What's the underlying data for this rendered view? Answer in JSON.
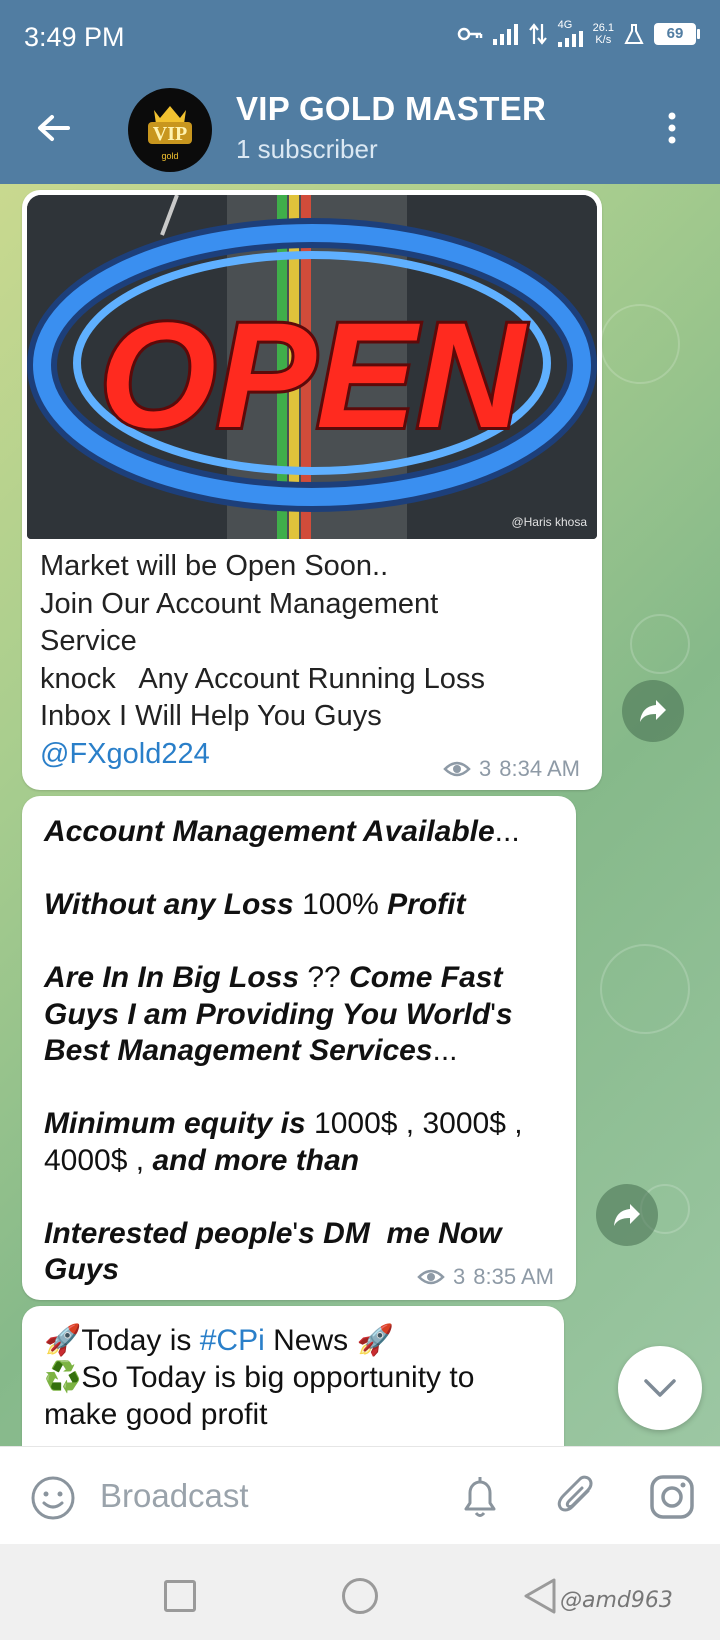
{
  "status_bar": {
    "time": "3:49 PM",
    "network": "4G",
    "speed_value": "26.1",
    "speed_unit": "K/s",
    "battery": "69",
    "icons": [
      "vpn-key-icon",
      "signal-icon",
      "data-transfer-icon",
      "signal-4g-icon",
      "flask-icon",
      "battery-icon"
    ]
  },
  "header": {
    "title": "VIP GOLD MASTER",
    "subtitle": "1 subscriber",
    "avatar_text": "VIP",
    "avatar_subtext": "gold",
    "back_icon": "arrow-left-icon",
    "menu_icon": "more-vertical-icon",
    "color": "#517da2"
  },
  "messages": [
    {
      "image_text": "OPEN",
      "image_credit": "@Haris khosa",
      "lines": [
        "Market will be Open Soon..",
        "Join Our Account Management",
        "Service",
        "knock   Any Account Running Loss",
        "Inbox I Will Help You Guys"
      ],
      "link": "@FXgold224",
      "views": "3",
      "time": "8:34 AM"
    },
    {
      "p1_bold": "Account Management Available",
      "p1_tail": "...",
      "p2_bold1": "Without any Loss",
      "p2_plain": " 100% ",
      "p2_bold2": "Profit",
      "p3_l1_bold1": "Are In In Big Loss",
      "p3_l1_plain": " ?? ",
      "p3_l1_bold2": "Come Fast",
      "p3_l2_bold": "Guys I am Providing You World",
      "p3_l2_plain": "'",
      "p3_l2_tail": "s",
      "p3_l3_bold": "Best Management Services",
      "p3_l3_tail": "...",
      "p4_l1_bold": "Minimum equity is",
      "p4_l1_plain": " 1000$ , 3000$ ,",
      "p4_l2_plain": "4000$ , ",
      "p4_l2_bold": "and more than",
      "p5_l1_bold1": "Interested people",
      "p5_l1_plain": "'",
      "p5_l1_bold2": "s DM  me Now",
      "p5_l2_bold": "Guys",
      "views": "3",
      "time": "8:35 AM"
    },
    {
      "l1_emoji": "🚀",
      "l1_a": "Today is ",
      "l1_hashtag": "#CPi",
      "l1_b": " News ",
      "l1_emoji2": "🚀",
      "l2_emoji": "♻️",
      "l2_text": "So Today is big opportunity to",
      "l3_text": "make good profit"
    }
  ],
  "input_bar": {
    "placeholder": "Broadcast",
    "icons": [
      "emoji-icon",
      "bell-icon",
      "paperclip-icon",
      "instagram-icon"
    ]
  },
  "nav_bar": {
    "watermark": "@amd963",
    "icons": [
      "recent-apps-icon",
      "home-icon",
      "back-triangle-icon"
    ]
  }
}
